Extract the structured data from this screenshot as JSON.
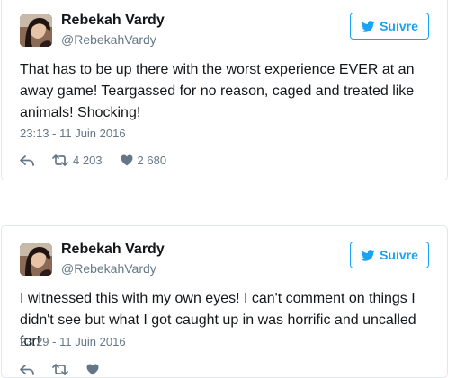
{
  "colors": {
    "accent": "#1da1f2",
    "text": "#14171a",
    "muted": "#657786",
    "border": "#e1e8ed"
  },
  "tweets": [
    {
      "author": {
        "name": "Rebekah Vardy",
        "handle": "@RebekahVardy",
        "avatar_icon": "avatar-photo"
      },
      "follow_label": "Suivre",
      "text": "That has to be up there with the worst experience EVER at an away game! Teargassed for no reason, caged and treated like animals! Shocking!",
      "date": "23:13 - 11 Juin 2016",
      "retweets": "4 203",
      "likes": "2 680"
    },
    {
      "author": {
        "name": "Rebekah Vardy",
        "handle": "@RebekahVardy",
        "avatar_icon": "avatar-photo"
      },
      "follow_label": "Suivre",
      "text": "I witnessed this with my own eyes! I can't comment on things I didn't see but what I got caught up in was horrific and uncalled for!",
      "date": "23:29 - 11 Juin 2016"
    }
  ]
}
